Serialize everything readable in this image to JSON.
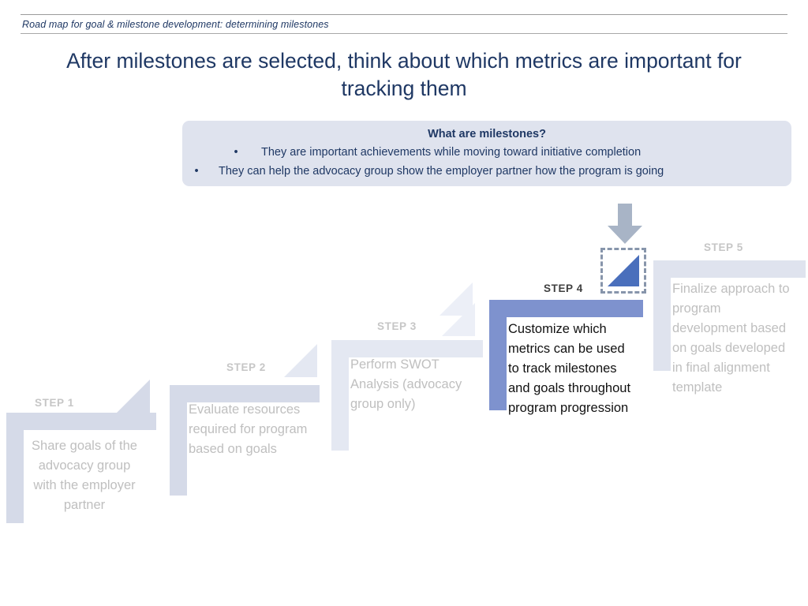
{
  "header": {
    "breadcrumb": "Road map for goal & milestone development: determining milestones"
  },
  "title": "After milestones are selected, think about which metrics are important for tracking them",
  "callout": {
    "heading": "What are milestones?",
    "bullet_glyph": "•",
    "bullets": [
      "They are important achievements while moving toward initiative completion",
      "They can help the advocacy group show the employer partner how the program is going"
    ]
  },
  "marker": {
    "arrow_name": "down-arrow",
    "selection_name": "selection-box"
  },
  "colors": {
    "title_blue": "#1f3864",
    "callout_bg": "#dfe3ee",
    "inactive_bracket": "#d5dae8",
    "inactive_bracket_light": "#e4e8f2",
    "active_bracket": "#7e92ce",
    "active_triangle": "#eceff7",
    "arrow": "#a8b4c6",
    "dash_border": "#8795ab",
    "selection_triangle": "#4a6fbc",
    "inactive_label": "#c6c6c6",
    "active_label": "#404040",
    "inactive_text": "#bfbfbf",
    "active_text": "#111111"
  },
  "steps": [
    {
      "label": "STEP 1",
      "text": "Share goals of the advocacy group with the employer partner",
      "align": "center",
      "active": false
    },
    {
      "label": "STEP 2",
      "text": "Evaluate resources required for program based on goals",
      "align": "left",
      "active": false
    },
    {
      "label": "STEP 3",
      "text": "Perform SWOT Analysis (advocacy group only)",
      "align": "left",
      "active": false
    },
    {
      "label": "STEP 4",
      "text": "Customize which metrics can be used to track milestones and goals throughout program progression",
      "align": "left",
      "active": true
    },
    {
      "label": "STEP 5",
      "text": "Finalize approach to program development based on goals developed in final alignment template",
      "align": "left",
      "active": false
    }
  ]
}
